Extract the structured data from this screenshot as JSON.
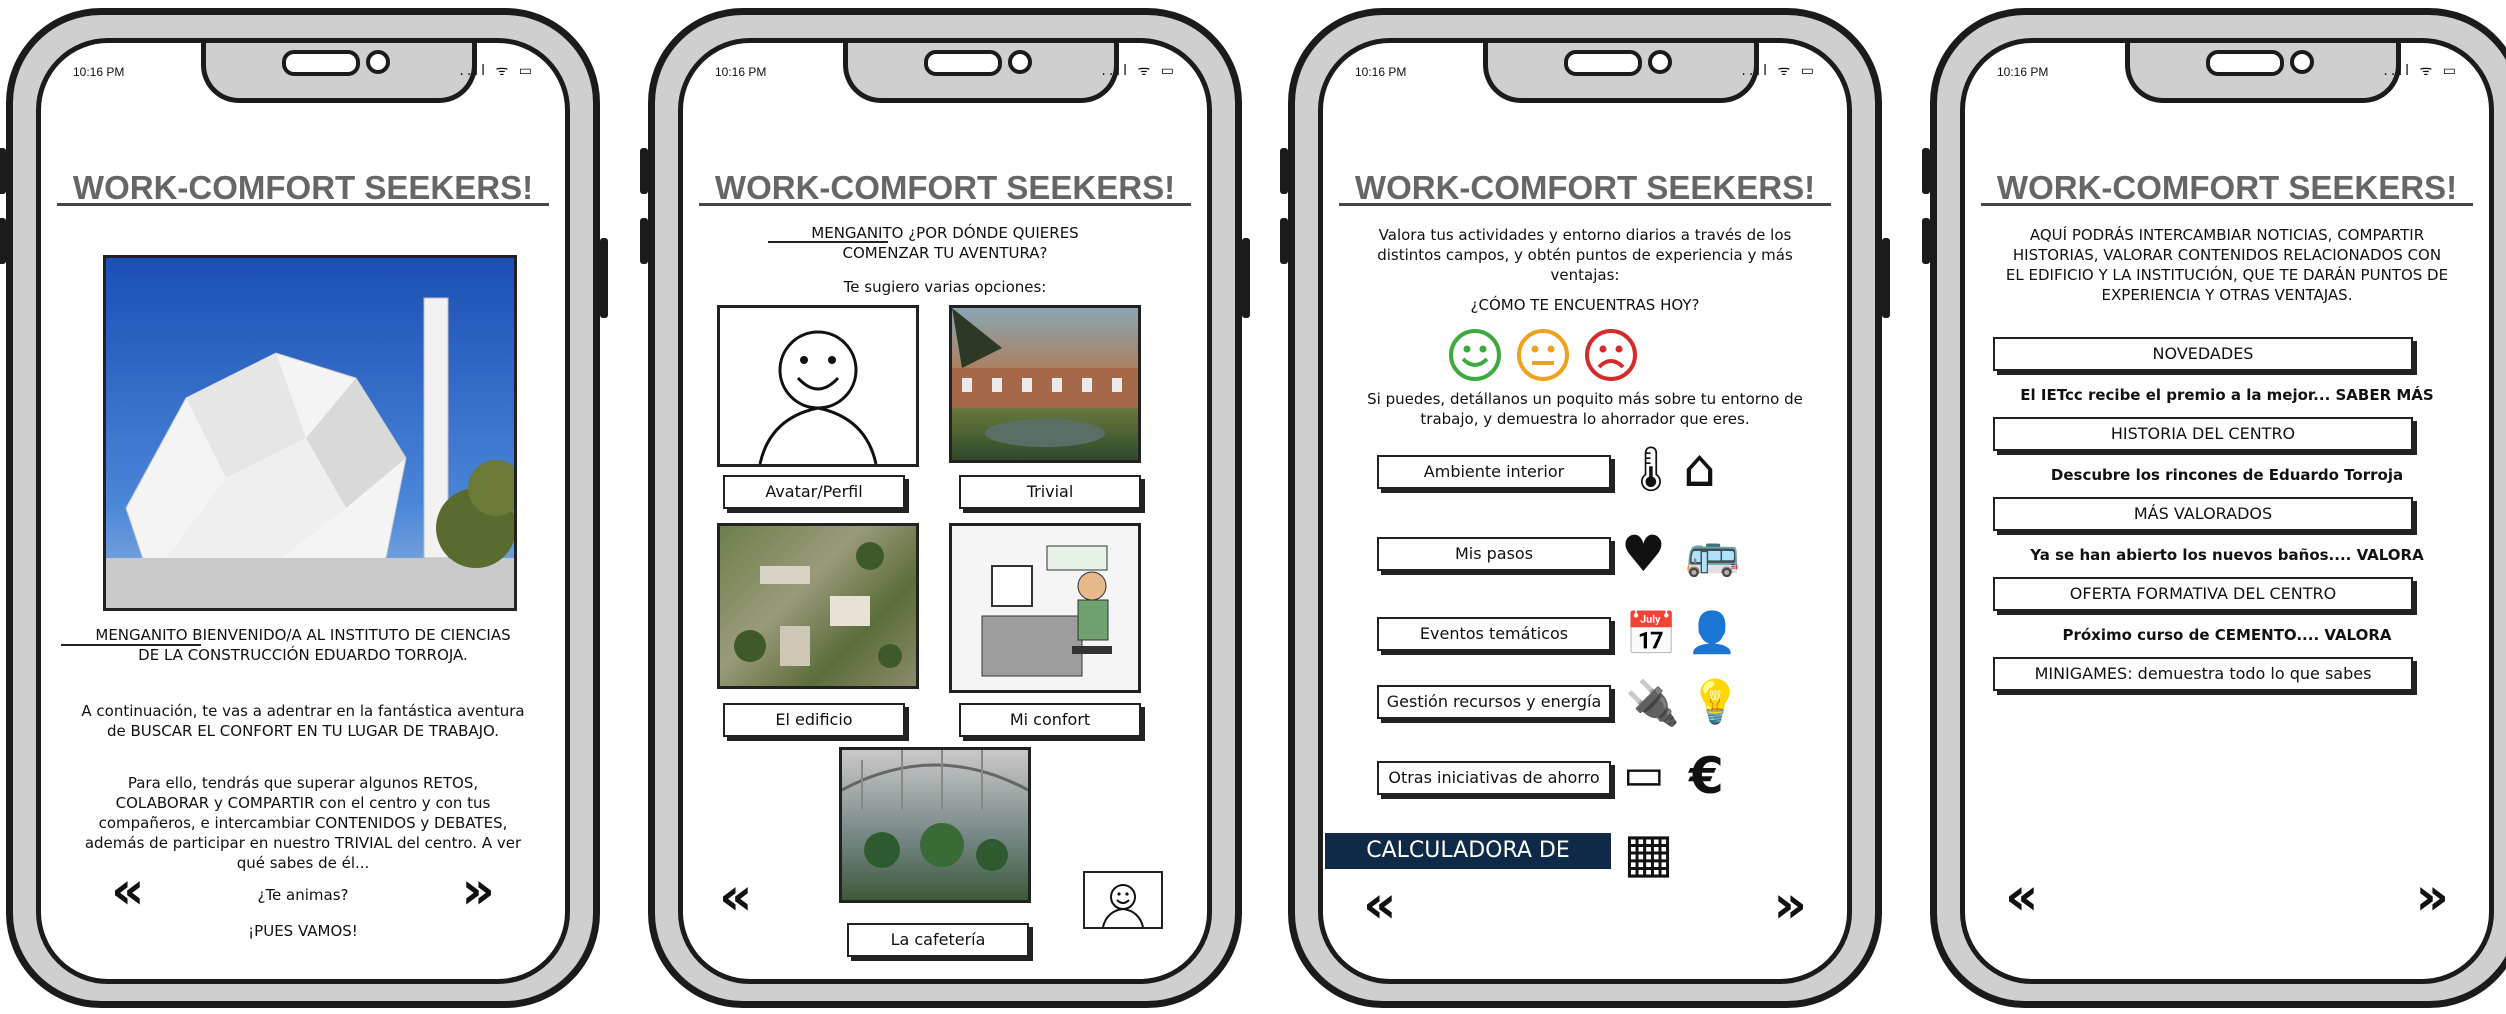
{
  "status": {
    "time": "10:16 PM",
    "signal": "..ıl",
    "wifi": "ᯤ",
    "battery": "▭"
  },
  "app_title": "WORK-COMFORT SEEKERS!",
  "screen1": {
    "welcome": "MENGANITO BIENVENIDO/A AL INSTITUTO DE CIENCIAS DE LA CONSTRUCCIÓN EDUARDO TORROJA.",
    "intro": "A continuación, te vas a adentrar en la fantástica aventura de BUSCAR EL CONFORT EN TU LUGAR DE TRABAJO.",
    "details": "Para ello, tendrás que superar algunos RETOS, COLABORAR y COMPARTIR con el centro y con tus compañeros, e intercambiar CONTENIDOS y DEBATES, además de participar en nuestro TRIVIAL del centro. A ver qué sabes de él...",
    "question": "¿Te animas?",
    "cta": "¡PUES VAMOS!",
    "prev": "«",
    "next": "»"
  },
  "screen2": {
    "heading": "MENGANITO ¿POR DÓNDE QUIERES COMENZAR TU AVENTURA?",
    "suggest": "Te sugiero varias opciones:",
    "options": [
      "Avatar/Perfil",
      "Trivial",
      "El edificio",
      "Mi confort",
      "La cafetería"
    ],
    "prev": "«"
  },
  "screen3": {
    "intro": "Valora tus actividades y entorno diarios a través de los distintos campos, y obtén puntos de experiencia y más ventajas:",
    "question": "¿CÓMO TE ENCUENTRAS HOY?",
    "detail": "Si puedes, detállanos un poquito más sobre tu entorno de trabajo, y demuestra lo ahorrador que eres.",
    "buttons": [
      "Ambiente interior",
      "Mis pasos",
      "Eventos temáticos",
      "Gestión recursos y energía",
      "Otras iniciativas de ahorro"
    ],
    "calculator": "CALCULADORA DE AHORRO",
    "icons": [
      "🌡",
      "⌂",
      "♥",
      "🚌",
      "📅",
      "👤",
      "🔌",
      "💡",
      "▭",
      "€",
      "▦"
    ],
    "prev": "«",
    "next": "»"
  },
  "screen4": {
    "intro": "AQUÍ PODRÁS INTERCAMBIAR NOTICIAS, COMPARTIR HISTORIAS, VALORAR CONTENIDOS RELACIONADOS CON EL EDIFICIO Y LA INSTITUCIÓN, QUE TE DARÁN PUNTOS DE EXPERIENCIA Y OTRAS VENTAJAS.",
    "sections": [
      {
        "label": "NOVEDADES",
        "teaser": "El IETcc recibe el premio a la mejor... SABER MÁS"
      },
      {
        "label": "HISTORIA DEL CENTRO",
        "teaser": "Descubre los rincones de Eduardo Torroja"
      },
      {
        "label": "MÁS VALORADOS",
        "teaser": "Ya se han abierto los nuevos baños.... VALORA"
      },
      {
        "label": "OFERTA FORMATIVA DEL CENTRO",
        "teaser": "Próximo curso de CEMENTO.... VALORA"
      },
      {
        "label": "MINIGAMES: demuestra todo lo que sabes",
        "teaser": ""
      }
    ],
    "prev": "«",
    "next": "»"
  }
}
